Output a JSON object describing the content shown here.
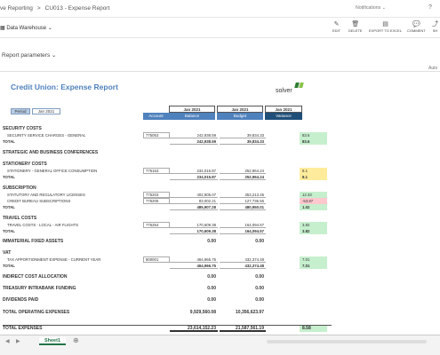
{
  "breadcrumb": {
    "part1": "ve Reporting",
    "sep": ">",
    "part2": "CU013 - Expense Report"
  },
  "header": {
    "notifications": "Notifications ⌄",
    "help": "?"
  },
  "toolbar": {
    "datasource": "Data Warehouse",
    "buttons": [
      {
        "label": "EDIT",
        "icon": "pencil-icon"
      },
      {
        "label": "DELETE",
        "icon": "trash-icon"
      },
      {
        "label": "EXPORT TO EXCEL",
        "icon": "excel-icon"
      },
      {
        "label": "COMMENT",
        "icon": "comment-icon"
      },
      {
        "label": "SH",
        "icon": "share-icon"
      }
    ]
  },
  "report_parameters": "Report parameters",
  "auto_label": "Auto",
  "report": {
    "title": "Credit Union: Expense Report",
    "logo_text": "solver",
    "period_label": "Period",
    "period_value": "Jan 2021",
    "col_period": "Jan 2021",
    "col_account": "Account",
    "col_balance": "Balance",
    "col_budget": "Budget",
    "col_variance": "Variance",
    "sections": [
      {
        "title": "SECURITY COSTS"
      },
      {
        "title": "STRATEGIC AND BUSINESS CONFERENCES"
      },
      {
        "title": "STATIONERY COSTS"
      },
      {
        "title": "SUBSCRIPTION"
      },
      {
        "title": "TRAVEL COSTS"
      },
      {
        "title": "IMMATERIAL FIXED ASSETS"
      },
      {
        "title": "VAT"
      },
      {
        "title": "INDIRECT COST ALLOCATION"
      },
      {
        "title": "TREASURY INTRABANK FUNDING"
      },
      {
        "title": "DIVIDENDS PAID"
      },
      {
        "title": "TOTAL OPERATING EXPENSES"
      },
      {
        "title": "TOTAL EXPENSES"
      }
    ],
    "lines": [
      {
        "name": "SECURITY SERVICE CHARGES - GENERAL",
        "account": "775053",
        "balance": "242,938.59",
        "budget": "39,834.33",
        "variance": "83.6"
      },
      {
        "name": "TOTAL",
        "balance": "242,938.59",
        "budget": "39,834.33",
        "variance": "83.6"
      },
      {
        "name": "STATIONERY - GENERAL OFFICE CONSUMPTION",
        "account": "775153",
        "balance": "234,015.87",
        "budget": "252,964.24",
        "variance": "8.1"
      },
      {
        "name": "TOTAL",
        "balance": "234,015.87",
        "budget": "252,964.24",
        "variance": "8.1"
      },
      {
        "name": "STATUTORY AND REGULATORY LICENSES",
        "account": "775203",
        "balance": "402,905.07",
        "budget": "353,213.45",
        "variance": "12.33"
      },
      {
        "name": "CREDIT BUREAU SUBSCRIPTIONS",
        "account": "775205",
        "balance": "83,002.21",
        "budget": "127,736.56",
        "variance": "-53.87"
      },
      {
        "name": "TOTAL",
        "balance": "485,907.28",
        "budget": "480,950.01",
        "variance": "1.02"
      },
      {
        "name": "TRAVEL COSTS - LOCAL - AIR FLIGHTS",
        "account": "775254",
        "balance": "170,609.38",
        "budget": "164,094.57",
        "variance": "3.82"
      },
      {
        "name": "TOTAL",
        "balance": "170,609.38",
        "budget": "164,094.57",
        "variance": "3.82"
      },
      {
        "zero_balance": "0.00",
        "zero_budget": "0.00"
      },
      {
        "name": "TAX APPORTIONMENT EXPENSE - CURRENT YEAR",
        "account": "800001",
        "balance": "464,966.75",
        "budget": "432,374.48",
        "variance": "7.01"
      },
      {
        "name": "TOTAL",
        "balance": "464,966.75",
        "budget": "432,374.48",
        "variance": "7.01"
      },
      {
        "balance": "9,929,560.08",
        "budget": "10,356,623.97"
      },
      {
        "name": "",
        "balance": "23,614,152.23",
        "budget": "21,587,561.19",
        "variance": "8.58"
      }
    ]
  },
  "sheet_tab": "Sheet1",
  "colors": {
    "accent": "#4f81bd",
    "positive": "#c6efce",
    "warning": "#ffeb9c",
    "negative": "#ffc7ce"
  }
}
